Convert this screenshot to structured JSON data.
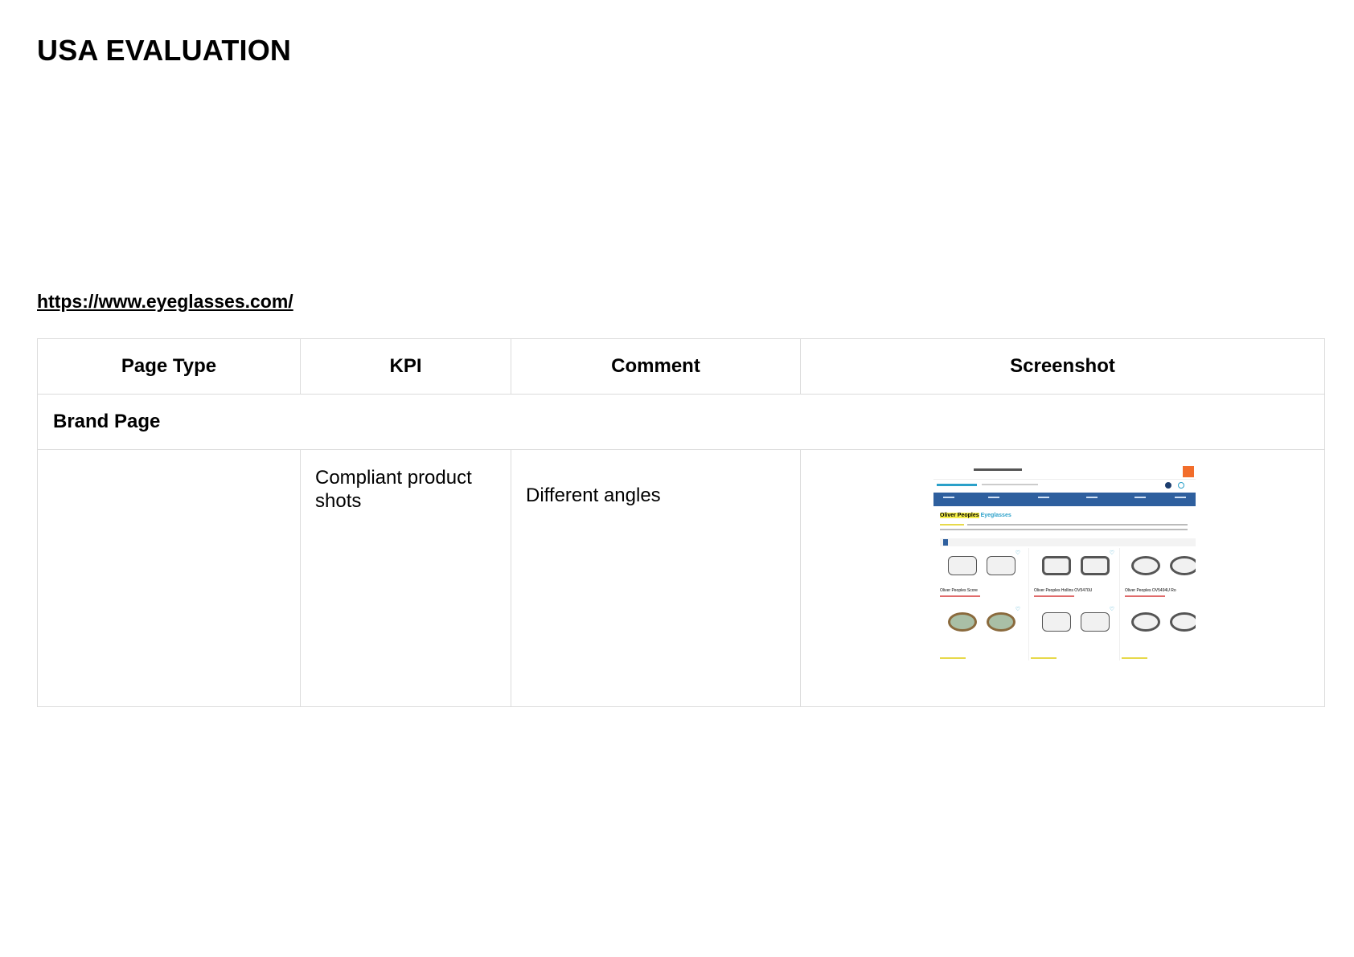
{
  "title": "USA EVALUATION",
  "url": "https://www.eyeglasses.com/",
  "table": {
    "headers": [
      "Page Type",
      "KPI",
      "Comment",
      "Screenshot"
    ],
    "section": "Brand Page",
    "rows": [
      {
        "page_type": "",
        "kpi": "Compliant product shots",
        "comment": "Different angles"
      }
    ]
  },
  "screenshot": {
    "brand_name": "Oliver Peoples",
    "brand_suffix": "Eyeglasses",
    "product_labels": [
      "Oliver Peoples Score",
      "Oliver Peoples Hollins OV5470U",
      "Oliver Peoples OV5494U Ro"
    ],
    "accent_orange": "#f26d2b",
    "nav_blue": "#2e5f9e",
    "highlight_yellow": "#f7f14a"
  }
}
